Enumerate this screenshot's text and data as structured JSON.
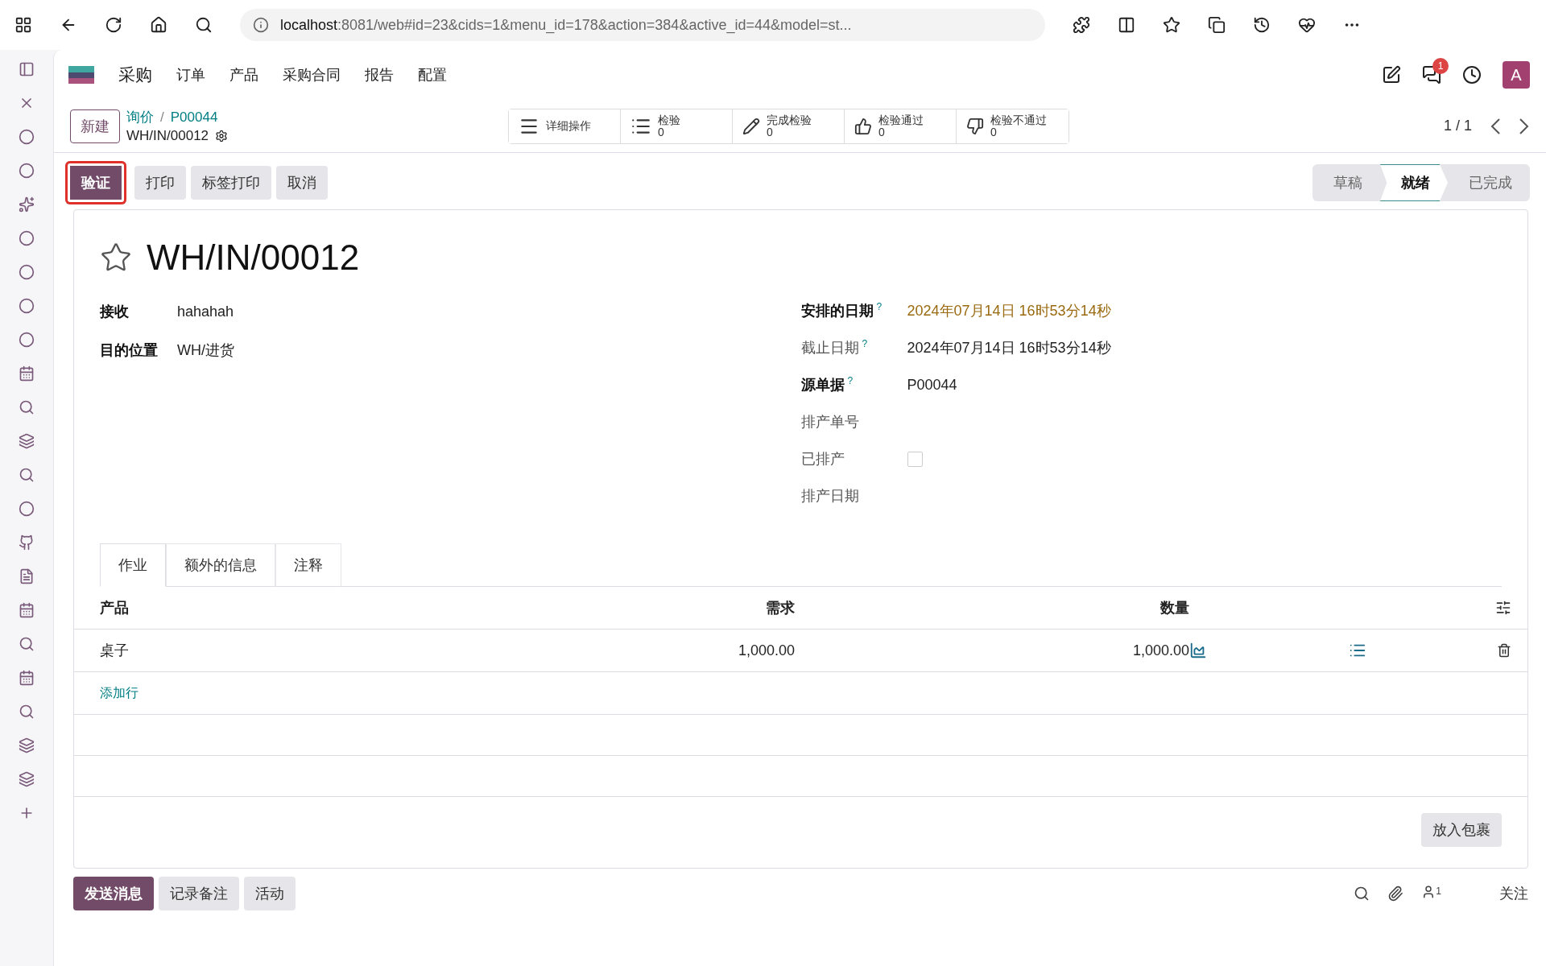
{
  "browser": {
    "url_host": "localhost",
    "url_rest": ":8081/web#id=23&cids=1&menu_id=178&action=384&active_id=44&model=st..."
  },
  "navbar": {
    "brand": "采购",
    "menu": [
      "订单",
      "产品",
      "采购合同",
      "报告",
      "配置"
    ],
    "message_count": "1",
    "avatar": "A"
  },
  "control_panel": {
    "new_button": "新建",
    "breadcrumb": [
      "询价",
      "P00044"
    ],
    "breadcrumb_separator": "/",
    "record": "WH/IN/00012",
    "pager": "1 / 1",
    "smart_buttons": [
      {
        "kind": "menu",
        "label": "详细操作"
      },
      {
        "kind": "list",
        "label": "检验",
        "count": "0"
      },
      {
        "kind": "pencil",
        "label": "完成检验",
        "count": "0"
      },
      {
        "kind": "thumbs-up",
        "label": "检验通过",
        "count": "0"
      },
      {
        "kind": "thumbs-down",
        "label": "检验不通过",
        "count": "0"
      }
    ]
  },
  "actions": [
    {
      "label": "验证",
      "primary": true,
      "outlined": true
    },
    {
      "label": "打印",
      "primary": false,
      "outlined": false
    },
    {
      "label": "标签打印",
      "primary": false,
      "outlined": false
    },
    {
      "label": "取消",
      "primary": false,
      "outlined": false
    }
  ],
  "statusbar": [
    {
      "label": "草稿",
      "selected": false
    },
    {
      "label": "就绪",
      "selected": true
    },
    {
      "label": "已完成",
      "selected": false
    }
  ],
  "form": {
    "title": "WH/IN/00012",
    "starred": false,
    "left_fields": [
      {
        "label": "接收",
        "value": "hahahah"
      },
      {
        "label": "目的位置",
        "value": "WH/进货"
      }
    ],
    "right_fields": [
      {
        "kind": "text",
        "label": "安排的日期",
        "required": true,
        "help": "?",
        "value": "2024年07月14日 16时53分14秒",
        "warning": true
      },
      {
        "kind": "text",
        "label": "截止日期",
        "required": false,
        "help": "?",
        "value": "2024年07月14日 16时53分14秒",
        "warning": false
      },
      {
        "kind": "text",
        "label": "源单据",
        "required": true,
        "help": "?",
        "value": "P00044",
        "warning": false
      },
      {
        "kind": "text",
        "label": "排产单号",
        "required": false
      },
      {
        "kind": "checkbox",
        "label": "已排产",
        "required": false,
        "checked": false
      },
      {
        "kind": "text",
        "label": "排产日期",
        "required": false
      }
    ],
    "tabs": [
      {
        "label": "作业",
        "selected": true
      },
      {
        "label": "额外的信息",
        "selected": false
      },
      {
        "label": "注释",
        "selected": false
      }
    ],
    "table": {
      "columns": [
        "产品",
        "需求",
        "数量"
      ],
      "rows": [
        {
          "product": "桌子",
          "demand": "1,000.00",
          "quantity": "1,000.00"
        }
      ],
      "add_line": "添加行"
    },
    "put_in_pack": "放入包裹"
  },
  "chatter": {
    "buttons": [
      {
        "label": "发送消息",
        "primary": true
      },
      {
        "label": "记录备注",
        "primary": false
      },
      {
        "label": "活动",
        "primary": false
      }
    ],
    "followers": "1",
    "follow": "关注"
  }
}
